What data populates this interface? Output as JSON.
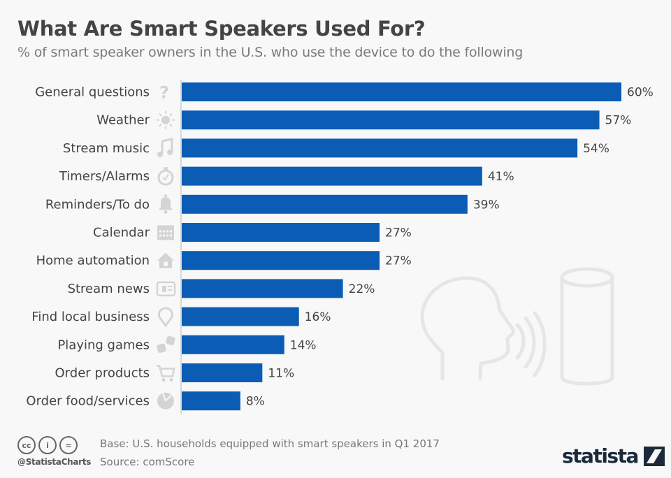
{
  "header": {
    "title": "What Are Smart Speakers Used For?",
    "subtitle": "% of smart speaker owners in the U.S. who use the device to do the following"
  },
  "chart_data": {
    "type": "bar",
    "orientation": "horizontal",
    "title": "What Are Smart Speakers Used For?",
    "subtitle": "% of smart speaker owners in the U.S. who use the device to do the following",
    "xlabel": "",
    "ylabel": "",
    "xlim": [
      0,
      60
    ],
    "grid": false,
    "bar_color": "#0b5cb5",
    "categories": [
      "General questions",
      "Weather",
      "Stream music",
      "Timers/Alarms",
      "Reminders/To do",
      "Calendar",
      "Home automation",
      "Stream news",
      "Find local business",
      "Playing games",
      "Order products",
      "Order food/services"
    ],
    "icons": [
      "question-icon",
      "sun-icon",
      "music-note-icon",
      "stopwatch-icon",
      "bell-icon",
      "calendar-icon",
      "house-icon",
      "newspaper-icon",
      "map-pin-icon",
      "dice-icon",
      "shopping-cart-icon",
      "pizza-icon"
    ],
    "values": [
      60,
      57,
      54,
      41,
      39,
      27,
      27,
      22,
      16,
      14,
      11,
      8
    ],
    "value_labels": [
      "60%",
      "57%",
      "54%",
      "41%",
      "39%",
      "27%",
      "27%",
      "22%",
      "16%",
      "14%",
      "11%",
      "8%"
    ]
  },
  "footer": {
    "cc_icons": [
      "cc",
      "i",
      "="
    ],
    "handle": "@StatistaCharts",
    "base": "Base: U.S. households equipped with smart speakers in Q1 2017",
    "source": "Source: comScore",
    "logo": "statista"
  }
}
